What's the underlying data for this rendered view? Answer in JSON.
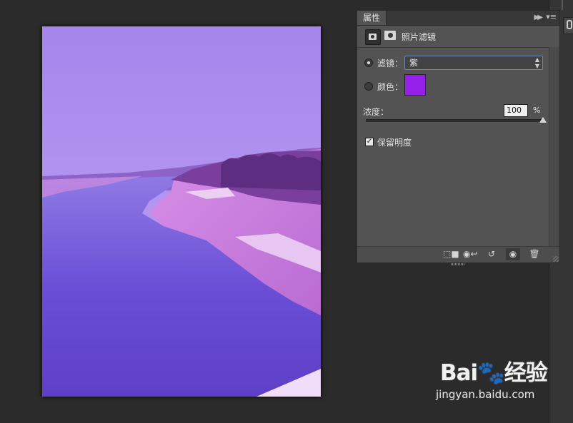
{
  "panel": {
    "tab_label": "属性",
    "title": "照片滤镜",
    "filter_label": "滤镜：",
    "filter_value": "紫",
    "color_label": "颜色：",
    "color_value": "#9520ea",
    "density_label": "浓度：",
    "density_value": "100",
    "density_unit": "%",
    "density_level": 1.0,
    "preserve_label": "保留明度",
    "preserve_checked": true,
    "selected_option": "filter"
  },
  "icons": {
    "collapse": "double-chevron-right-icon",
    "menu": "panel-menu-icon",
    "adjustment": "photo-filter-adjustment-icon",
    "mask": "layer-mask-icon",
    "footer": [
      "clip-to-layer-icon",
      "view-previous-state-icon",
      "reset-icon",
      "visibility-eye-icon",
      "trash-icon"
    ]
  },
  "watermark": {
    "logo": "Bai🐾经验",
    "url": "jingyan.baidu.com"
  }
}
